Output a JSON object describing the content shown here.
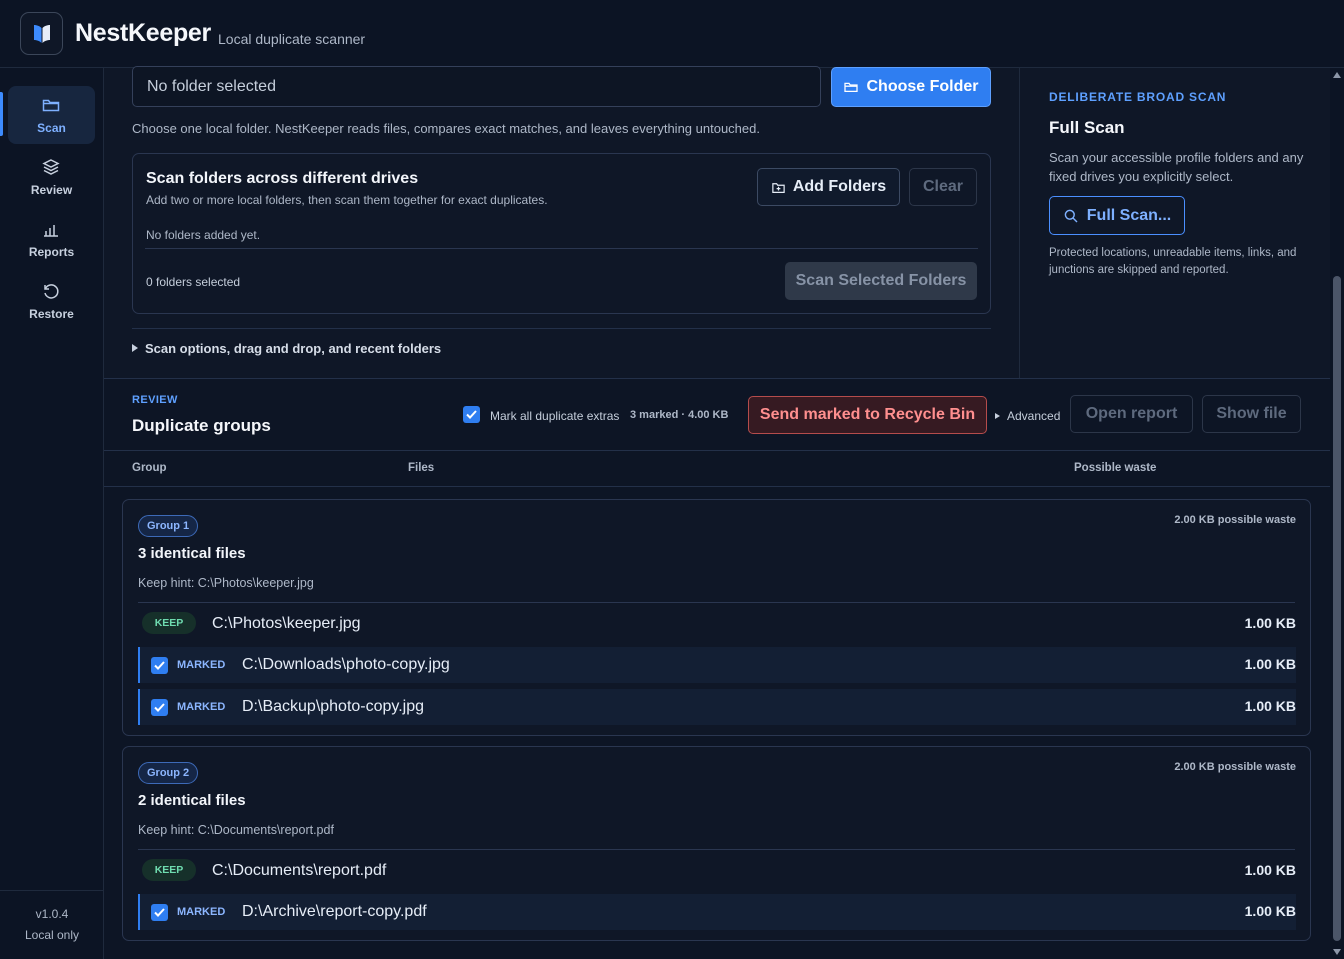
{
  "app": {
    "name": "NestKeeper",
    "subtitle": "Local duplicate scanner",
    "version": "v1.0.4",
    "mode": "Local only"
  },
  "nav": [
    {
      "label": "Scan",
      "icon": "folder-icon",
      "active": true
    },
    {
      "label": "Review",
      "icon": "layers-icon"
    },
    {
      "label": "Reports",
      "icon": "bar-chart-icon"
    },
    {
      "label": "Restore",
      "icon": "restore-icon"
    }
  ],
  "scan": {
    "folder_placeholder": "No folder selected",
    "choose_label": "Choose Folder",
    "help": "Choose one local folder. NestKeeper reads files, compares exact matches, and leaves everything untouched.",
    "multi": {
      "title": "Scan folders across different drives",
      "subtitle": "Add two or more local folders, then scan them together for exact duplicates.",
      "add_label": "Add Folders",
      "clear_label": "Clear",
      "empty": "No folders added yet.",
      "count": "0 folders selected",
      "scan_label": "Scan Selected Folders"
    },
    "options_label": "Scan options, drag and drop, and recent folders"
  },
  "full_scan": {
    "tag": "DELIBERATE BROAD SCAN",
    "title": "Full Scan",
    "description": "Scan your accessible profile folders and any fixed drives you explicitly select.",
    "button": "Full Scan...",
    "note": "Protected locations, unreadable items, links, and junctions are skipped and reported."
  },
  "review": {
    "tag": "REVIEW",
    "title": "Duplicate groups",
    "mark_all_label": "Mark all duplicate extras",
    "mark_count": "3 marked · 4.00 KB",
    "send_label": "Send marked to Recycle Bin",
    "advanced_label": "Advanced",
    "open_report": "Open report",
    "show_file": "Show file",
    "columns": [
      "Group",
      "Files",
      "Possible waste"
    ]
  },
  "groups": [
    {
      "label": "Group 1",
      "title": "3 identical files",
      "waste": "2.00 KB possible waste",
      "hint": "Keep hint: C:\\Photos\\keeper.jpg",
      "files": [
        {
          "status": "KEEP",
          "path": "C:\\Photos\\keeper.jpg",
          "size": "1.00 KB"
        },
        {
          "status": "MARKED",
          "path": "C:\\Downloads\\photo-copy.jpg",
          "size": "1.00 KB"
        },
        {
          "status": "MARKED",
          "path": "D:\\Backup\\photo-copy.jpg",
          "size": "1.00 KB"
        }
      ]
    },
    {
      "label": "Group 2",
      "title": "2 identical files",
      "waste": "2.00 KB possible waste",
      "hint": "Keep hint: C:\\Documents\\report.pdf",
      "files": [
        {
          "status": "KEEP",
          "path": "C:\\Documents\\report.pdf",
          "size": "1.00 KB"
        },
        {
          "status": "MARKED",
          "path": "D:\\Archive\\report-copy.pdf",
          "size": "1.00 KB"
        }
      ]
    }
  ],
  "colors": {
    "accent": "#2f7ef1",
    "danger": "#ff8f8f",
    "keep": "#6fdcb0",
    "background": "#0f1727"
  }
}
